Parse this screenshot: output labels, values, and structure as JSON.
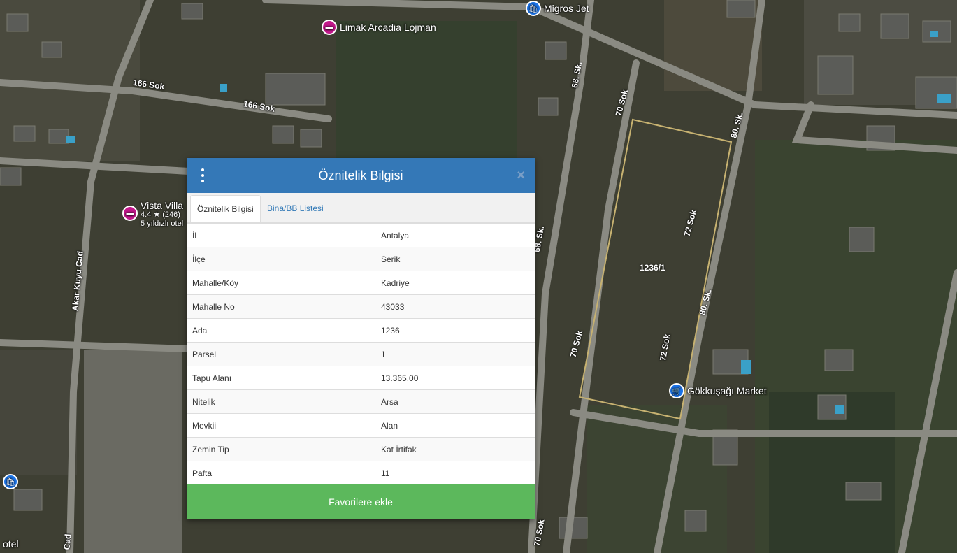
{
  "map": {
    "road_labels": [
      "166 Sok",
      "166 Sok",
      "68. Sk.",
      "68. Sk.",
      "70 Sok",
      "70 Sok",
      "70 Sok",
      "72 Sok",
      "72 Sok",
      "80. Sk.",
      "80. Sk.",
      "Akar Kuyu Cad",
      "Cad"
    ],
    "pois": {
      "migros": "Migros Jet",
      "limak": "Limak Arcadia Lojman",
      "vista": "Vista Villa",
      "vista_rating": "4.4 ★ (246)",
      "vista_type": "5 yıldızlı otel",
      "market": "Gökkuşağı Market",
      "otel": "otel"
    },
    "parcel_label": "1236/1"
  },
  "panel": {
    "title": "Öznitelik Bilgisi",
    "close": "×",
    "tabs": [
      "Öznitelik Bilgisi",
      "Bina/BB Listesi"
    ],
    "rows": [
      {
        "key": "İl",
        "value": "Antalya"
      },
      {
        "key": "İlçe",
        "value": "Serik"
      },
      {
        "key": "Mahalle/Köy",
        "value": "Kadriye"
      },
      {
        "key": "Mahalle No",
        "value": "43033"
      },
      {
        "key": "Ada",
        "value": "1236"
      },
      {
        "key": "Parsel",
        "value": "1"
      },
      {
        "key": "Tapu Alanı",
        "value": "13.365,00"
      },
      {
        "key": "Nitelik",
        "value": "Arsa"
      },
      {
        "key": "Mevkii",
        "value": "Alan"
      },
      {
        "key": "Zemin Tip",
        "value": "Kat İrtifak"
      },
      {
        "key": "Pafta",
        "value": "11"
      }
    ],
    "favorite_button": "Favorilere ekle"
  }
}
